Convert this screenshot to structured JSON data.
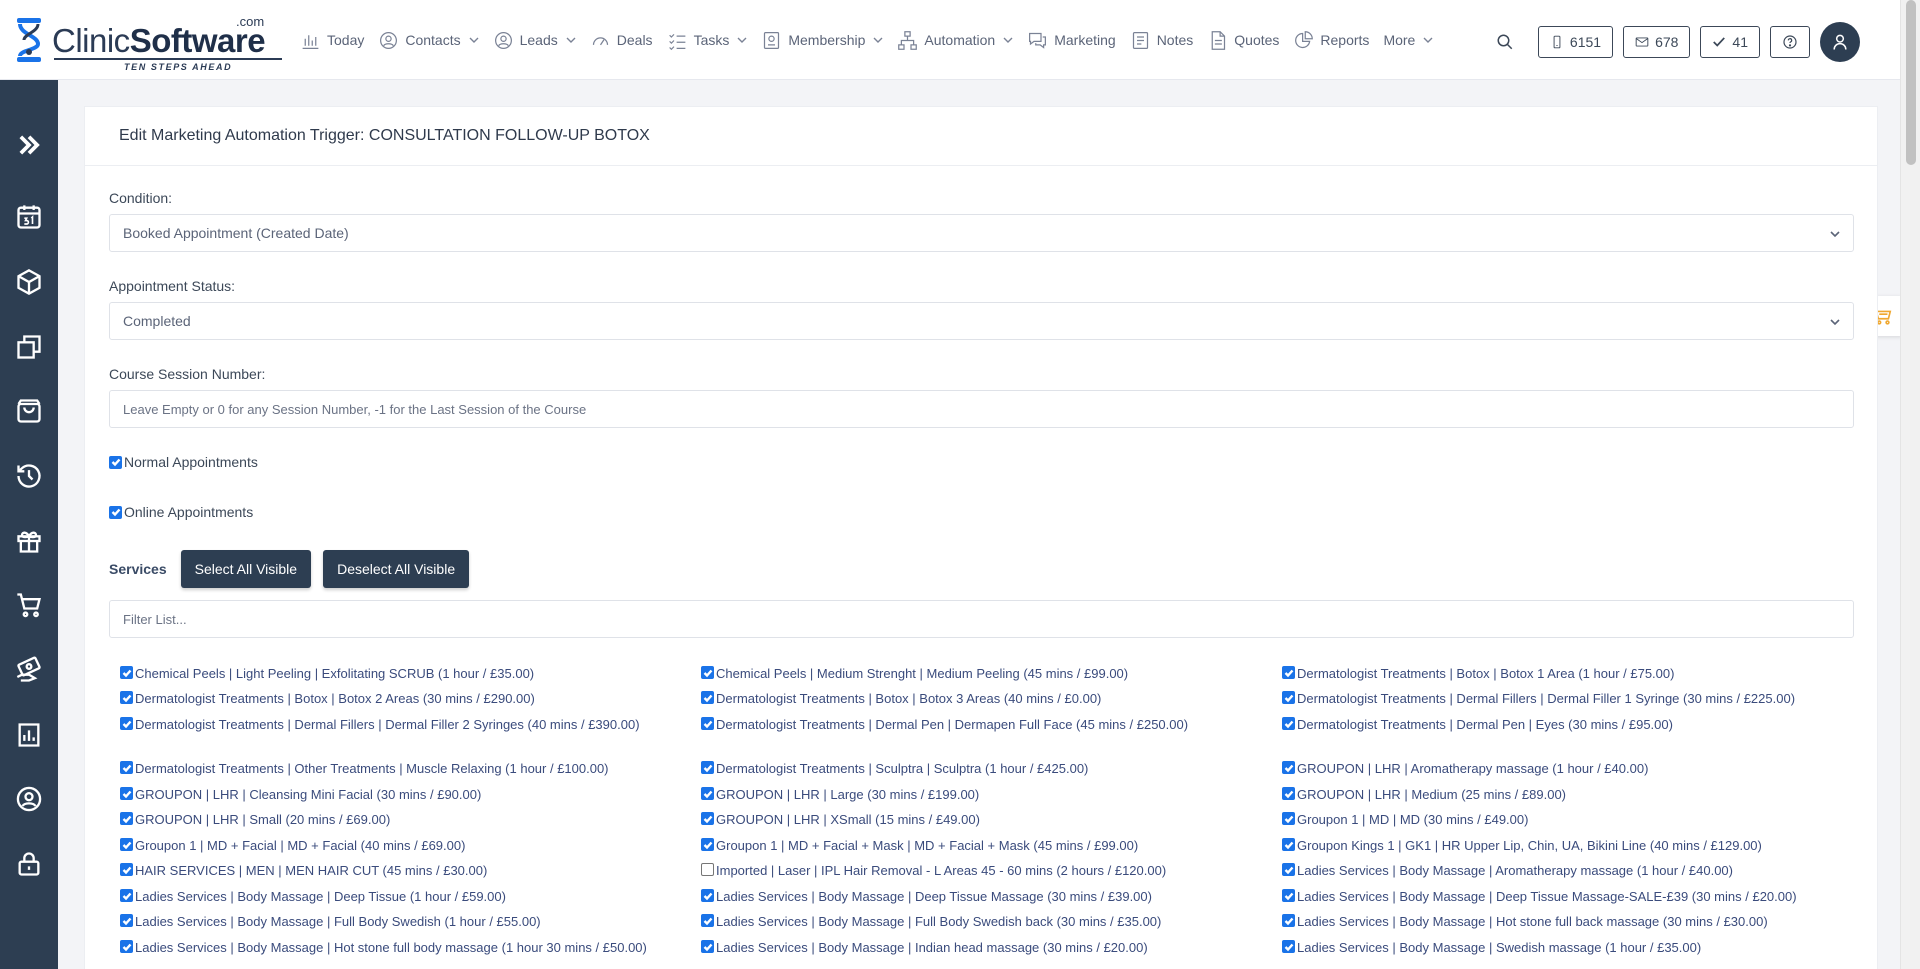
{
  "brand": {
    "name_part1": "Clinic",
    "name_part2": "Software",
    "com": ".com",
    "tagline": "TEN STEPS AHEAD"
  },
  "nav": [
    {
      "label": "Today",
      "icon": "chart-bar-icon",
      "chevron": false
    },
    {
      "label": "Contacts",
      "icon": "contacts-icon",
      "chevron": true
    },
    {
      "label": "Leads",
      "icon": "user-circle-icon",
      "chevron": true
    },
    {
      "label": "Deals",
      "icon": "gauge-icon",
      "chevron": false
    },
    {
      "label": "Tasks",
      "icon": "checklist-icon",
      "chevron": true
    },
    {
      "label": "Membership",
      "icon": "membership-card-icon",
      "chevron": true
    },
    {
      "label": "Automation",
      "icon": "sitemap-icon",
      "chevron": true
    },
    {
      "label": "Marketing",
      "icon": "chat-bubbles-icon",
      "chevron": false
    },
    {
      "label": "Notes",
      "icon": "notes-icon",
      "chevron": false
    },
    {
      "label": "Quotes",
      "icon": "document-icon",
      "chevron": false
    },
    {
      "label": "Reports",
      "icon": "pie-chart-icon",
      "chevron": false
    },
    {
      "label": "More",
      "icon": "",
      "chevron": true
    }
  ],
  "counters": {
    "sms": "6151",
    "email": "678",
    "tasks": "41"
  },
  "sidebar_icons": [
    "double-chevron-right-icon",
    "calendar-31-icon",
    "box-icon",
    "copy-icon",
    "shopping-bag-icon",
    "history-icon",
    "gift-icon",
    "cart-icon",
    "money-hand-icon",
    "bar-chart-icon",
    "user-circle-icon",
    "lock-icon"
  ],
  "page": {
    "title": "Edit Marketing Automation Trigger: CONSULTATION FOLLOW-UP BOTOX",
    "condition_label": "Condition:",
    "condition_value": "Booked Appointment (Created Date)",
    "status_label": "Appointment Status:",
    "status_value": "Completed",
    "session_label": "Course Session Number:",
    "session_placeholder": "Leave Empty or 0 for any Session Number, -1 for the Last Session of the Course",
    "normal_label": "Normal Appointments",
    "online_label": "Online Appointments",
    "services_label": "Services",
    "select_all": "Select All Visible",
    "deselect_all": "Deselect All Visible",
    "filter_placeholder": "Filter List..."
  },
  "services": [
    [
      {
        "text": "Chemical Peels | Light Peeling | Exfolitating SCRUB (1 hour / £35.00)",
        "checked": true
      },
      {
        "text": "Dermatologist Treatments | Botox | Botox 2 Areas (30 mins / £290.00)",
        "checked": true
      },
      {
        "text": "Dermatologist Treatments | Dermal Fillers | Dermal Filler 2 Syringes (40 mins / £390.00)",
        "checked": true
      },
      {
        "text": "Dermatologist Treatments | Other Treatments | Muscle Relaxing (1 hour / £100.00)",
        "checked": true
      },
      {
        "text": "GROUPON | LHR | Cleansing Mini Facial (30 mins / £90.00)",
        "checked": true
      },
      {
        "text": "GROUPON | LHR | Small (20 mins / £69.00)",
        "checked": true
      },
      {
        "text": "Groupon 1 | MD + Facial | MD + Facial (40 mins / £69.00)",
        "checked": true
      },
      {
        "text": "HAIR SERVICES | MEN | MEN HAIR CUT (45 mins / £30.00)",
        "checked": true
      },
      {
        "text": "Ladies Services | Body Massage | Deep Tissue (1 hour / £59.00)",
        "checked": true
      },
      {
        "text": "Ladies Services | Body Massage | Full Body Swedish (1 hour / £55.00)",
        "checked": true
      },
      {
        "text": "Ladies Services | Body Massage | Hot stone full body massage (1 hour 30 mins / £50.00)",
        "checked": true
      }
    ],
    [
      {
        "text": "Chemical Peels | Medium Strenght | Medium Peeling (45 mins / £99.00)",
        "checked": true
      },
      {
        "text": "Dermatologist Treatments | Botox | Botox 3 Areas (40 mins / £0.00)",
        "checked": true
      },
      {
        "text": "Dermatologist Treatments | Dermal Pen | Dermapen Full Face (45 mins / £250.00)",
        "checked": true
      },
      {
        "text": "Dermatologist Treatments | Sculptra | Sculptra (1 hour / £425.00)",
        "checked": true
      },
      {
        "text": "GROUPON | LHR | Large (30 mins / £199.00)",
        "checked": true
      },
      {
        "text": "GROUPON | LHR | XSmall (15 mins / £49.00)",
        "checked": true
      },
      {
        "text": "Groupon 1 | MD + Facial + Mask | MD + Facial + Mask (45 mins / £99.00)",
        "checked": true
      },
      {
        "text": "Imported | Laser | IPL Hair Removal - L Areas 45 - 60 mins (2 hours / £120.00)",
        "checked": false
      },
      {
        "text": "Ladies Services | Body Massage | Deep Tissue Massage (30 mins / £39.00)",
        "checked": true
      },
      {
        "text": "Ladies Services | Body Massage | Full Body Swedish back (30 mins / £35.00)",
        "checked": true
      },
      {
        "text": "Ladies Services | Body Massage | Indian head massage (30 mins / £20.00)",
        "checked": true
      }
    ],
    [
      {
        "text": "Dermatologist Treatments | Botox | Botox 1 Area (1 hour / £75.00)",
        "checked": true
      },
      {
        "text": "Dermatologist Treatments | Dermal Fillers | Dermal Filler 1 Syringe (30 mins / £225.00)",
        "checked": true
      },
      {
        "text": "Dermatologist Treatments | Dermal Pen | Eyes (30 mins / £95.00)",
        "checked": true
      },
      {
        "text": "GROUPON | LHR | Aromatherapy massage (1 hour / £40.00)",
        "checked": true
      },
      {
        "text": "GROUPON | LHR | Medium (25 mins / £89.00)",
        "checked": true
      },
      {
        "text": "Groupon 1 | MD | MD (30 mins / £49.00)",
        "checked": true
      },
      {
        "text": "Groupon Kings 1 | GK1 | HR Upper Lip, Chin, UA, Bikini Line (40 mins / £129.00)",
        "checked": true
      },
      {
        "text": "Ladies Services | Body Massage | Aromatherapy massage (1 hour / £40.00)",
        "checked": true
      },
      {
        "text": "Ladies Services | Body Massage | Deep Tissue Massage-SALE-£39 (30 mins / £20.00)",
        "checked": true
      },
      {
        "text": "Ladies Services | Body Massage | Hot stone full back massage (30 mins / £30.00)",
        "checked": true
      },
      {
        "text": "Ladies Services | Body Massage | Swedish massage (1 hour / £35.00)",
        "checked": true
      }
    ]
  ]
}
